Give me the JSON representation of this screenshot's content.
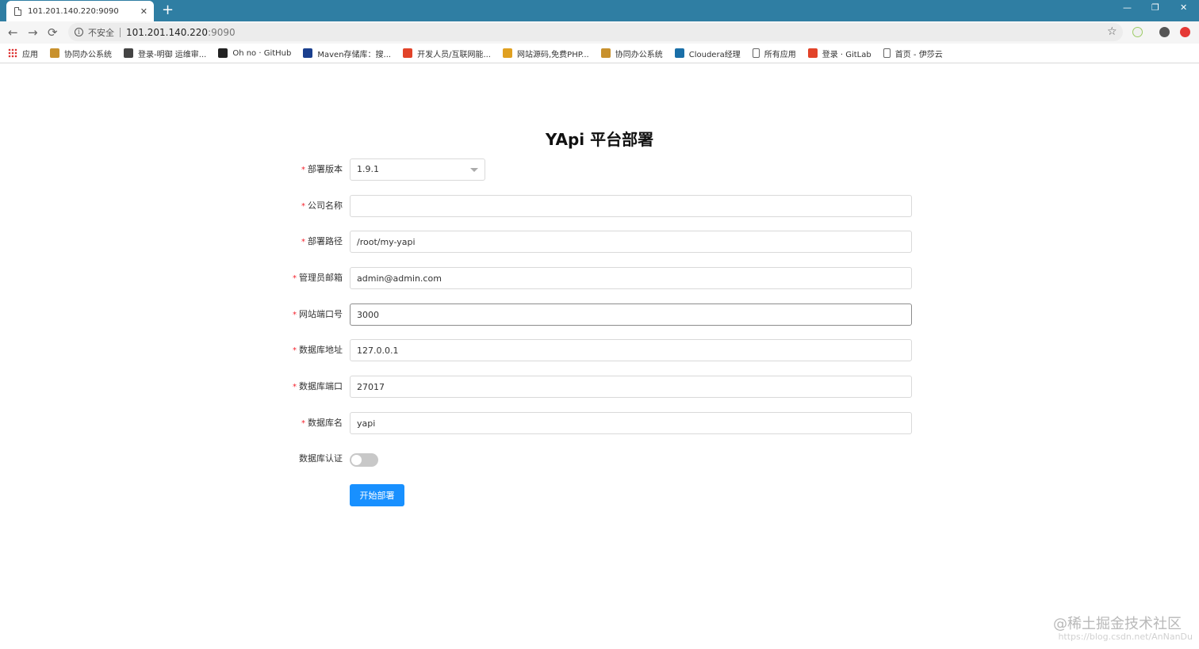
{
  "browser": {
    "tab_title": "101.201.140.220:9090",
    "tab_close": "✕",
    "new_tab": "+",
    "minimize": "—",
    "restore": "❐",
    "close": "✕",
    "back": "←",
    "forward": "→",
    "reload": "⟳",
    "insecure_label": "不安全",
    "url_host": "101.201.140.220",
    "url_port": ":9090",
    "star": "☆"
  },
  "bookmarks": [
    {
      "label": "应用",
      "icon": "apps-grid-icon",
      "color": "#d93025"
    },
    {
      "label": "协同办公系统",
      "icon": "kingdee-icon",
      "color": "#c8912d"
    },
    {
      "label": "登录-明御 运维审...",
      "icon": "shield-icon",
      "color": "#444444"
    },
    {
      "label": "Oh no · GitHub",
      "icon": "github-icon",
      "color": "#222222"
    },
    {
      "label": "Maven存储库：搜...",
      "icon": "maven-icon",
      "color": "#1a3f8e"
    },
    {
      "label": "开发人员/互联网能...",
      "icon": "gitlab-icon",
      "color": "#e24329"
    },
    {
      "label": "网站源码,免费PHP...",
      "icon": "php-site-icon",
      "color": "#e0a020"
    },
    {
      "label": "协同办公系统",
      "icon": "kingdee-icon",
      "color": "#c8912d"
    },
    {
      "label": "Cloudera经理",
      "icon": "cloudera-icon",
      "color": "#1a6fa8"
    },
    {
      "label": "所有应用",
      "icon": "page-icon",
      "color": "#666666"
    },
    {
      "label": "登录 · GitLab",
      "icon": "gitlab-icon",
      "color": "#e24329"
    },
    {
      "label": "首页 - 伊莎云",
      "icon": "page-icon",
      "color": "#666666"
    }
  ],
  "page": {
    "title": "YApi 平台部署",
    "required_mark": "*",
    "fields": {
      "version": {
        "label": "部署版本",
        "value": "1.9.1"
      },
      "company": {
        "label": "公司名称",
        "value": ""
      },
      "path": {
        "label": "部署路径",
        "value": "/root/my-yapi"
      },
      "admin_email": {
        "label": "管理员邮箱",
        "value": "admin@admin.com"
      },
      "site_port": {
        "label": "网站端口号",
        "value": "3000"
      },
      "db_host": {
        "label": "数据库地址",
        "value": "127.0.0.1"
      },
      "db_port": {
        "label": "数据库端口",
        "value": "27017"
      },
      "db_name": {
        "label": "数据库名",
        "value": "yapi"
      },
      "db_auth": {
        "label": "数据库认证",
        "enabled": false
      }
    },
    "submit_label": "开始部署"
  },
  "watermark": {
    "text": "@稀土掘金技术社区",
    "subtext": "https://blog.csdn.net/AnNanDu"
  }
}
